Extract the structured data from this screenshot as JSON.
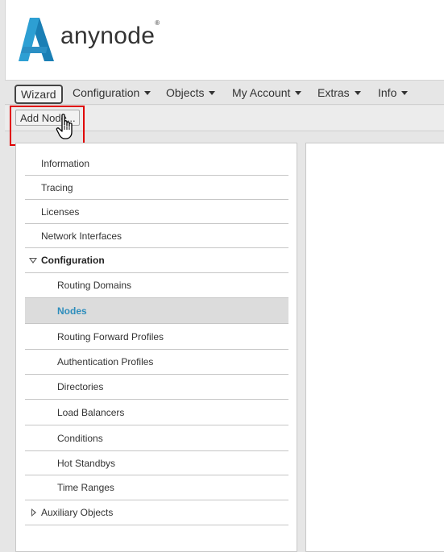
{
  "brand": {
    "name": "anynode",
    "mark": "®",
    "color": "#2d9fd3"
  },
  "menu": {
    "wizard": "Wizard",
    "items": [
      "Configuration",
      "Objects",
      "My Account",
      "Extras",
      "Info"
    ]
  },
  "toolbar": {
    "add_node_label": "Add Node..."
  },
  "nav": {
    "information": "Information",
    "tracing": "Tracing",
    "licenses": "Licenses",
    "network_interfaces": "Network Interfaces",
    "configuration": "Configuration",
    "routing_domains": "Routing Domains",
    "nodes": "Nodes",
    "routing_forward_profiles": "Routing Forward Profiles",
    "authentication_profiles": "Authentication Profiles",
    "directories": "Directories",
    "load_balancers": "Load Balancers",
    "conditions": "Conditions",
    "hot_standbys": "Hot Standbys",
    "time_ranges": "Time Ranges",
    "auxiliary_objects": "Auxiliary Objects"
  },
  "colors": {
    "highlight": "#e00000",
    "selected_text": "#2d8dbc"
  }
}
